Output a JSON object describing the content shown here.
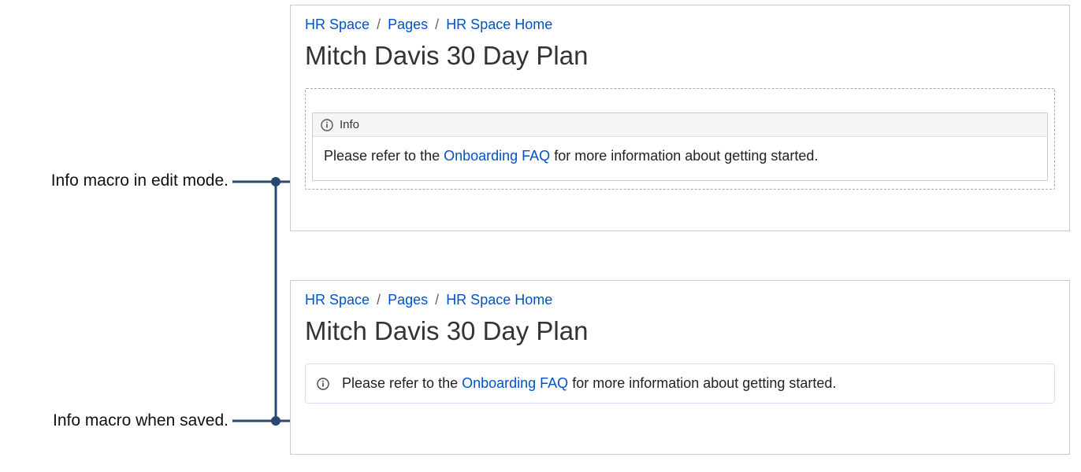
{
  "annotations": {
    "edit": "Info macro in edit mode.",
    "saved": "Info macro when saved."
  },
  "breadcrumb": {
    "space": "HR Space",
    "pages": "Pages",
    "home": "HR Space Home"
  },
  "page": {
    "title": "Mitch Davis 30 Day Plan"
  },
  "macro": {
    "label": "Info",
    "body_prefix": "Please refer to the ",
    "body_link": "Onboarding FAQ",
    "body_suffix": " for more information about getting started."
  }
}
